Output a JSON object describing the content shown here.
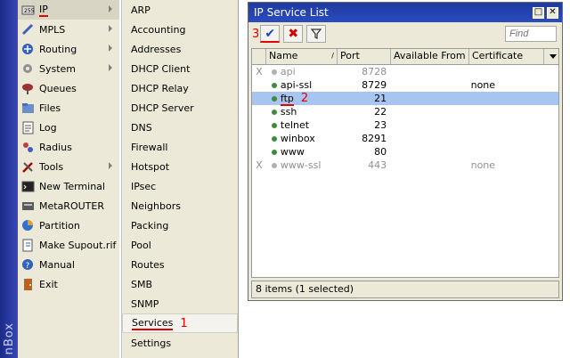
{
  "brand": {
    "strip_text": "nBox"
  },
  "main_menu": [
    {
      "label": "IP",
      "icon": "ip-icon",
      "arrow": true,
      "selected": true
    },
    {
      "label": "MPLS",
      "icon": "mpls-icon",
      "arrow": true
    },
    {
      "label": "Routing",
      "icon": "routing-icon",
      "arrow": true
    },
    {
      "label": "System",
      "icon": "system-gear-icon",
      "arrow": true
    },
    {
      "label": "Queues",
      "icon": "queues-icon"
    },
    {
      "label": "Files",
      "icon": "files-folder-icon"
    },
    {
      "label": "Log",
      "icon": "log-icon"
    },
    {
      "label": "Radius",
      "icon": "radius-icon"
    },
    {
      "label": "Tools",
      "icon": "tools-icon",
      "arrow": true
    },
    {
      "label": "New Terminal",
      "icon": "terminal-icon"
    },
    {
      "label": "MetaROUTER",
      "icon": "metarouter-icon"
    },
    {
      "label": "Partition",
      "icon": "partition-icon"
    },
    {
      "label": "Make Supout.rif",
      "icon": "supout-icon"
    },
    {
      "label": "Manual",
      "icon": "manual-help-icon"
    },
    {
      "label": "Exit",
      "icon": "exit-icon"
    }
  ],
  "sub_menu": [
    "ARP",
    "Accounting",
    "Addresses",
    "DHCP Client",
    "DHCP Relay",
    "DHCP Server",
    "DNS",
    "Firewall",
    "Hotspot",
    "IPsec",
    "Neighbors",
    "Packing",
    "Pool",
    "Routes",
    "SMB",
    "SNMP",
    "Services",
    "Settings"
  ],
  "annotations": {
    "services": "1",
    "ftp": "2",
    "enable": "3"
  },
  "window": {
    "title": "IP Service List",
    "find_placeholder": "Find",
    "columns": [
      "Name",
      "Port",
      "Available From",
      "Certificate"
    ],
    "rows": [
      {
        "flag": "X",
        "name": "api",
        "port": "8728",
        "from": "",
        "cert": "",
        "disabled": true
      },
      {
        "flag": "",
        "name": "api-ssl",
        "port": "8729",
        "from": "",
        "cert": "none"
      },
      {
        "flag": "",
        "name": "ftp",
        "port": "21",
        "from": "",
        "cert": "",
        "selected": true
      },
      {
        "flag": "",
        "name": "ssh",
        "port": "22",
        "from": "",
        "cert": ""
      },
      {
        "flag": "",
        "name": "telnet",
        "port": "23",
        "from": "",
        "cert": ""
      },
      {
        "flag": "",
        "name": "winbox",
        "port": "8291",
        "from": "",
        "cert": ""
      },
      {
        "flag": "",
        "name": "www",
        "port": "80",
        "from": "",
        "cert": ""
      },
      {
        "flag": "X",
        "name": "www-ssl",
        "port": "443",
        "from": "",
        "cert": "none",
        "disabled": true
      }
    ],
    "status": "8 items (1 selected)"
  },
  "colors": {
    "accent_title": "#2a4cc0",
    "selection": "#a8c4f0",
    "annotation": "#e00000",
    "menu_bg": "#ece9d8"
  }
}
